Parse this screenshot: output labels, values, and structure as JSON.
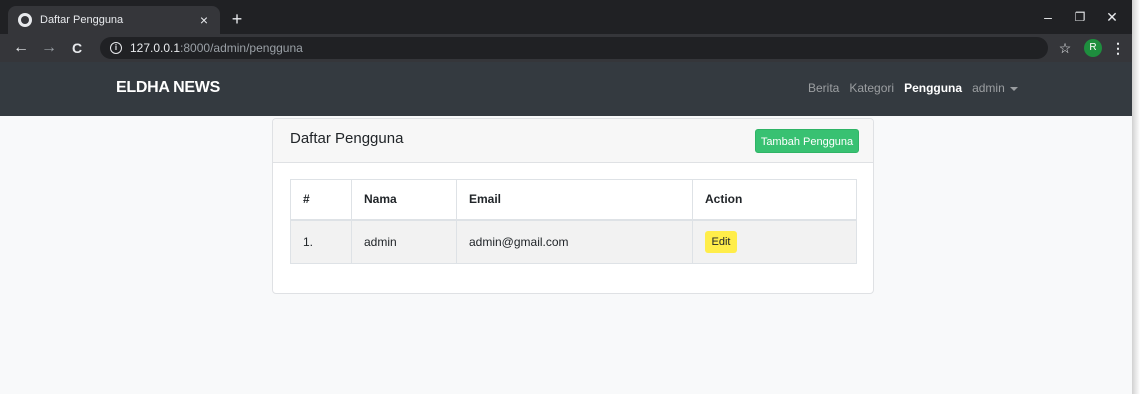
{
  "browser": {
    "tab_title": "Daftar Pengguna",
    "tab_close": "×",
    "new_tab": "+",
    "win_minimize": "–",
    "win_restore": "❐",
    "win_close": "✕",
    "back": "←",
    "forward": "→",
    "reload": "C",
    "info": "i",
    "url_host": "127.0.0.1",
    "url_rest": ":8000/admin/pengguna",
    "bookmark_star": "☆",
    "profile_initial": "R",
    "menu": "⋮"
  },
  "navbar": {
    "brand": "ELDHA NEWS",
    "links": [
      {
        "label": "Berita"
      },
      {
        "label": "Kategori"
      },
      {
        "label": "Pengguna"
      },
      {
        "label": "admin"
      }
    ]
  },
  "card": {
    "title": "Daftar Pengguna",
    "add_button": "Tambah Pengguna"
  },
  "table": {
    "headers": [
      "#",
      "Nama",
      "Email",
      "Action"
    ],
    "rows": [
      {
        "no": "1.",
        "nama": "admin",
        "email": "admin@gmail.com",
        "action": "Edit"
      }
    ]
  },
  "colors": {
    "navbar_bg": "#343a40",
    "success": "#38c172",
    "warning": "#ffed4a",
    "page_bg": "#f8f9fa"
  }
}
